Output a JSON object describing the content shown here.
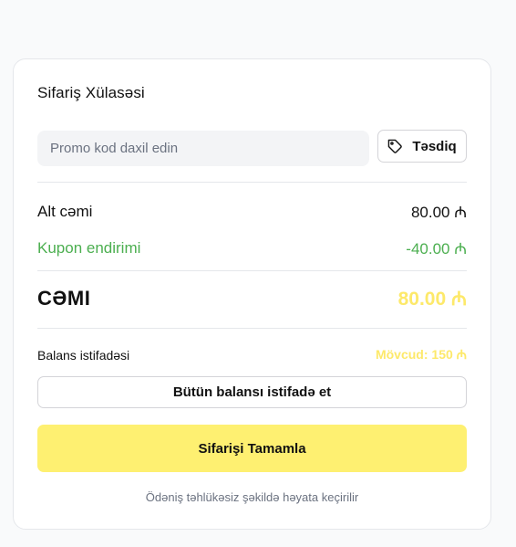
{
  "summary": {
    "title": "Sifariş Xülasəsi"
  },
  "promo": {
    "placeholder": "Promo kod daxil edin",
    "value": "",
    "apply_label": "Təsdiq",
    "apply_icon": "tag-icon"
  },
  "totals": {
    "subtotal_label": "Alt cəmi",
    "subtotal_value": "80.00 ₼",
    "discount_label": "Kupon endirimi",
    "discount_value": "-40.00 ₼",
    "total_label": "CƏMI",
    "total_value": "80.00 ₼"
  },
  "balance": {
    "label": "Balans istifadəsi",
    "available": "Mövcud: 150 ₼",
    "use_all_label": "Bütün balansı istifadə et"
  },
  "checkout": {
    "button_label": "Sifarişi Tamamla",
    "secure_note": "Ödəniş təhlükəsiz şəkildə həyata keçirilir"
  },
  "colors": {
    "accent_yellow": "#fef071",
    "total_yellow": "#fde96a",
    "discount_green": "#4caf50",
    "muted_text": "#6b7280",
    "border": "#e5e7eb"
  }
}
